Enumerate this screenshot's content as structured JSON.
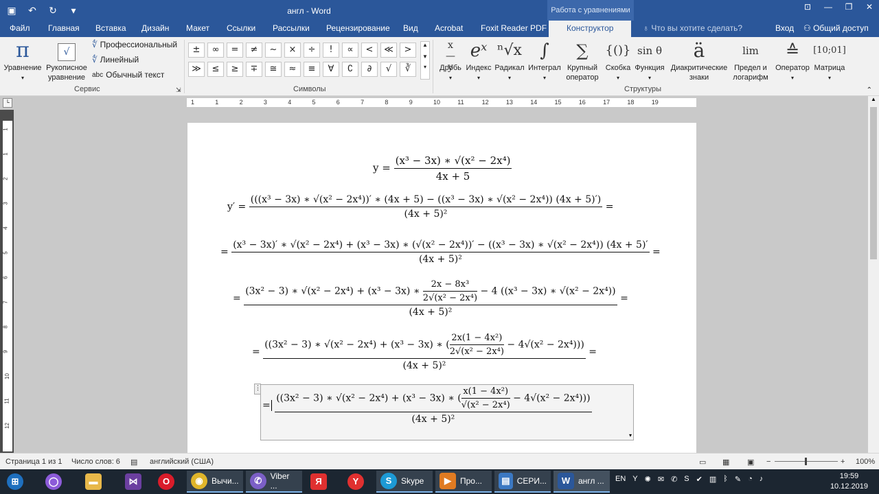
{
  "title_bar": {
    "document_title": "англ - Word",
    "context_title": "Работа с уравнениями",
    "qat_icons": [
      "save-icon",
      "undo-icon",
      "redo-icon",
      "customize-icon"
    ]
  },
  "tabs": {
    "items": [
      "Файл",
      "Главная",
      "Вставка",
      "Дизайн",
      "Макет",
      "Ссылки",
      "Рассылки",
      "Рецензирование",
      "Вид",
      "Acrobat",
      "Foxit Reader PDF"
    ],
    "active": "Конструктор",
    "search_placeholder": "Что вы хотите сделать?",
    "signin": "Вход",
    "share": "Общий доступ"
  },
  "ribbon": {
    "service": {
      "equation": "Уравнение",
      "ink_line1": "Рукописное",
      "ink_line2": "уравнение",
      "professional": "Профессиональный",
      "linear": "Линейный",
      "normal_text": "Обычный текст",
      "normal_text_prefix": "abc",
      "group_label": "Сервис"
    },
    "symbols": {
      "items": [
        "±",
        "∞",
        "=",
        "≠",
        "~",
        "×",
        "÷",
        "!",
        "∝",
        "<",
        "≪",
        ">",
        "≫",
        "≤",
        "≥",
        "∓",
        "≅",
        "≈",
        "≡",
        "∀",
        "∁",
        "∂",
        "√",
        "∛"
      ],
      "group_label": "Символы"
    },
    "structures": {
      "items": [
        {
          "label": "Дробь",
          "glyph": "x⁄y"
        },
        {
          "label": "Индекс",
          "glyph": "eˣ"
        },
        {
          "label": "Радикал",
          "glyph": "ⁿ√x"
        },
        {
          "label": "Интеграл",
          "glyph": "∫"
        },
        {
          "label": "Крупный оператор",
          "glyph": "∑"
        },
        {
          "label": "Скобка",
          "glyph": "{()}"
        },
        {
          "label": "Функция",
          "glyph": "sin θ"
        },
        {
          "label": "Диакритические знаки",
          "glyph": "ä"
        },
        {
          "label": "Предел и логарифм",
          "glyph": "lim"
        },
        {
          "label": "Оператор",
          "glyph": "≙"
        },
        {
          "label": "Матрица",
          "glyph": "[10;01]"
        }
      ],
      "group_label": "Структуры"
    }
  },
  "ruler": {
    "ticks": [
      "1",
      "1",
      "2",
      "3",
      "4",
      "5",
      "6",
      "7",
      "8",
      "9",
      "10",
      "11",
      "12",
      "13",
      "14",
      "15",
      "16",
      "17",
      "18",
      "19"
    ],
    "vticks": [
      "1",
      "1",
      "2",
      "3",
      "4",
      "5",
      "6",
      "7",
      "8",
      "9",
      "10",
      "11",
      "12"
    ]
  },
  "document": {
    "eq1_lhs": "y =",
    "eq1_num": "(x³ − 3x) ∗ √(x² − 2x⁴)",
    "eq1_den": "4x + 5",
    "eq2_lhs": "y′ =",
    "eq2_num": "(((x³ − 3x) ∗ √(x² − 2x⁴))′ ∗ (4x + 5) − ((x³ − 3x) ∗ √(x² − 2x⁴)) (4x + 5)′)",
    "eq2_den": "(4x + 5)²",
    "eq_tail": "=",
    "eq3_num": "(x³ − 3x)′ ∗ √(x² − 2x⁴) + (x³ − 3x) ∗ (√(x² − 2x⁴))′ − ((x³ − 3x) ∗ √(x² − 2x⁴)) (4x + 5)′",
    "eq3_den": "(4x + 5)²",
    "eq4_num_a": "(3x² − 3) ∗ √(x² − 2x⁴) + (x³ − 3x) ∗",
    "eq4_inner_num": "2x − 8x³",
    "eq4_inner_den": "2√(x² − 2x⁴)",
    "eq4_num_b": "− 4 ((x³ − 3x) ∗ √(x² − 2x⁴))",
    "eq4_den": "(4x + 5)²",
    "eq5_num_a": "((3x² − 3) ∗ √(x² − 2x⁴) + (x³ − 3x) ∗ (",
    "eq5_inner_num": "2x(1 − 4x²)",
    "eq5_inner_den": "2√(x² − 2x⁴)",
    "eq5_num_b": "− 4√(x² − 2x⁴)))",
    "eq5_den": "(4x + 5)²",
    "eq6_num_a": "((3x² − 3) ∗ √(x² − 2x⁴) + (x³ − 3x) ∗ (",
    "eq6_inner_num": "x(1 − 4x²)",
    "eq6_inner_den": "√(x² − 2x⁴)",
    "eq6_num_b": "− 4√(x² − 2x⁴)))",
    "eq6_den": "(4x + 5)²"
  },
  "status_bar": {
    "page": "Страница 1 из 1",
    "words": "Число слов: 6",
    "language": "английский (США)",
    "zoom": "100%"
  },
  "taskbar": {
    "items": [
      {
        "label": "Вычи...",
        "icon": "chrome-icon"
      },
      {
        "label": "Viber ...",
        "icon": "viber-icon"
      },
      {
        "label": "Skype",
        "icon": "skype-icon"
      },
      {
        "label": "Про...",
        "icon": "media-player-icon"
      },
      {
        "label": "СЕРИ...",
        "icon": "document-viewer-icon"
      },
      {
        "label": "англ ...",
        "icon": "word-icon"
      }
    ],
    "lang": "EN",
    "time": "19:59",
    "date": "10.12.2019"
  }
}
